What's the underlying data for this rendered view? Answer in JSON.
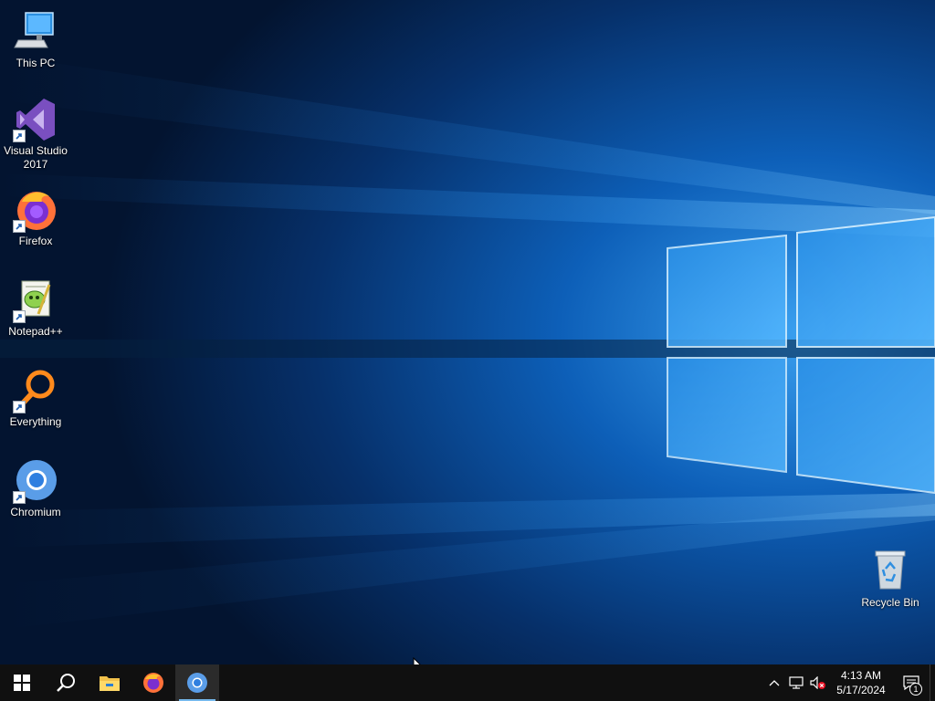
{
  "desktop": {
    "icons": [
      {
        "label": "This PC",
        "icon": "this-pc-icon",
        "shortcut": false
      },
      {
        "label": "Visual Studio\n2017",
        "icon": "visual-studio-icon",
        "shortcut": true
      },
      {
        "label": "Firefox",
        "icon": "firefox-icon",
        "shortcut": true
      },
      {
        "label": "Notepad++",
        "icon": "notepad-plus-plus-icon",
        "shortcut": true
      },
      {
        "label": "Everything",
        "icon": "everything-search-icon",
        "shortcut": true
      },
      {
        "label": "Chromium",
        "icon": "chromium-icon",
        "shortcut": true
      }
    ],
    "recycle_bin": {
      "label": "Recycle Bin",
      "icon": "recycle-bin-icon"
    }
  },
  "taskbar": {
    "buttons": [
      {
        "name": "start",
        "icon": "windows-logo-icon"
      },
      {
        "name": "search",
        "icon": "search-icon"
      },
      {
        "name": "file-explorer",
        "icon": "file-explorer-icon"
      },
      {
        "name": "firefox",
        "icon": "firefox-icon"
      },
      {
        "name": "chromium",
        "icon": "chromium-icon",
        "active": true
      }
    ],
    "tray": {
      "icons": [
        "chevron-up-icon",
        "network-icon",
        "volume-muted-icon"
      ],
      "time": "4:13 AM",
      "date": "5/17/2024",
      "notification_count": "1"
    }
  },
  "colors": {
    "wallpaper_base": "#03152e",
    "wallpaper_accent": "#1a7ad6",
    "taskbar": "#101010",
    "active_indicator": "#76b9ed"
  }
}
